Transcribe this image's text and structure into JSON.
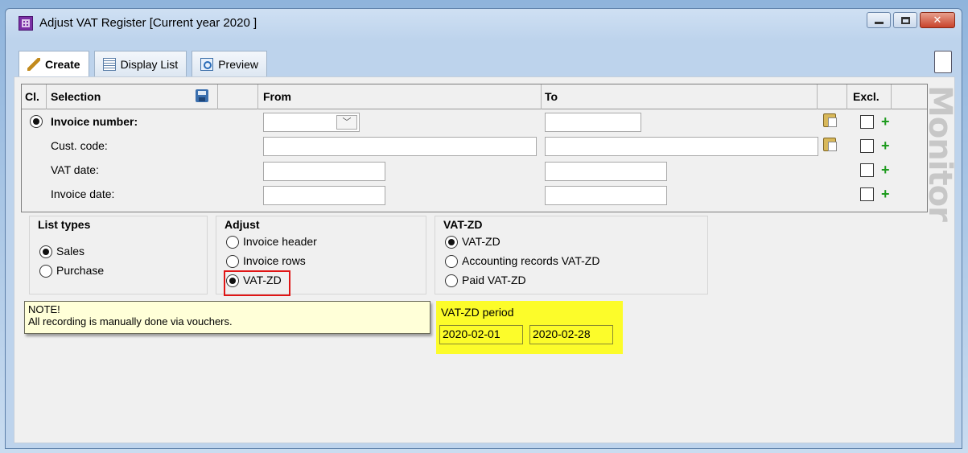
{
  "window": {
    "title": "Adjust VAT Register [Current year 2020 ]",
    "controls": {
      "minimize": "minimize-icon",
      "maximize": "maximize-icon",
      "close": "✕"
    }
  },
  "tabs": [
    {
      "label": "Create",
      "icon": "pencil-icon",
      "active": true
    },
    {
      "label": "Display List",
      "icon": "list-icon",
      "active": false
    },
    {
      "label": "Preview",
      "icon": "preview-icon",
      "active": false
    }
  ],
  "selection": {
    "headers": {
      "cl": "Cl.",
      "selection": "Selection",
      "from": "From",
      "to": "To",
      "excl": "Excl."
    },
    "rows": [
      {
        "label": "Invoice number:",
        "selected": true,
        "from": "",
        "to": ""
      },
      {
        "label": "Cust. code:",
        "from": "",
        "to": ""
      },
      {
        "label": "VAT date:",
        "from": "",
        "to": ""
      },
      {
        "label": "Invoice date:",
        "from": "",
        "to": ""
      }
    ],
    "plus": "+"
  },
  "watermark": "Monitor",
  "list_types": {
    "title": "List types",
    "options": [
      "Sales",
      "Purchase"
    ],
    "selected": "Sales"
  },
  "adjust": {
    "title": "Adjust",
    "options": [
      "Invoice header",
      "Invoice rows",
      "VAT-ZD"
    ],
    "selected": "VAT-ZD"
  },
  "vatzd": {
    "title": "VAT-ZD",
    "options": [
      "VAT-ZD",
      "Accounting records VAT-ZD",
      "Paid VAT-ZD"
    ],
    "selected": "VAT-ZD"
  },
  "note": {
    "line1": "NOTE!",
    "line2": "All recording is manually done via vouchers."
  },
  "vat_period": {
    "label": "VAT-ZD period",
    "from": "2020-02-01",
    "to": "2020-02-28"
  },
  "colors": {
    "highlight": "#fcfc2a",
    "emphasis_border": "#e01515",
    "note_bg": "#ffffd8",
    "plus": "#1e9b1e"
  }
}
